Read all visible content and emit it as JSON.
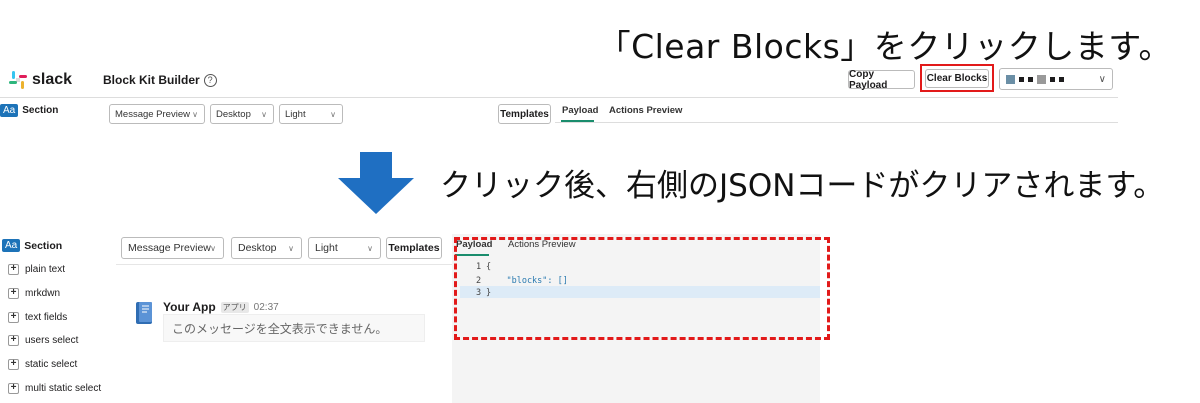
{
  "captions": {
    "step1": "「Clear Blocks」をクリックします。",
    "step2": "クリック後、右側のJSONコードがクリアされます。"
  },
  "top": {
    "logo_text": "slack",
    "app_title": "Block Kit Builder",
    "help_icon": "?",
    "copy_payload_label": "Copy Payload",
    "clear_blocks_label": "Clear Blocks",
    "section_badge": "Aa",
    "section_label": "Section",
    "selects": {
      "preview": "Message Preview",
      "device": "Desktop",
      "theme": "Light"
    },
    "templates_label": "Templates",
    "tabs": {
      "payload": "Payload",
      "actions": "Actions Preview"
    }
  },
  "bottom": {
    "section_badge": "Aa",
    "section_label": "Section",
    "sidebar_items": [
      "plain text",
      "mrkdwn",
      "text fields",
      "users select",
      "static select",
      "multi static select"
    ],
    "selects": {
      "preview": "Message Preview",
      "device": "Desktop",
      "theme": "Light"
    },
    "templates_label": "Templates",
    "tabs": {
      "payload": "Payload",
      "actions": "Actions Preview"
    },
    "message": {
      "app_name": "Your App",
      "app_badge": "アプリ",
      "time": "02:37",
      "body": "このメッセージを全文表示できません。"
    },
    "code": {
      "line_numbers": [
        "1",
        "2",
        "3"
      ],
      "lines": [
        "{",
        "    \"blocks\": []",
        "}"
      ]
    }
  },
  "colors": {
    "highlight_red": "#e21a1a",
    "arrow_blue": "#1f6fc2",
    "slack_green": "#1a8d6d"
  }
}
